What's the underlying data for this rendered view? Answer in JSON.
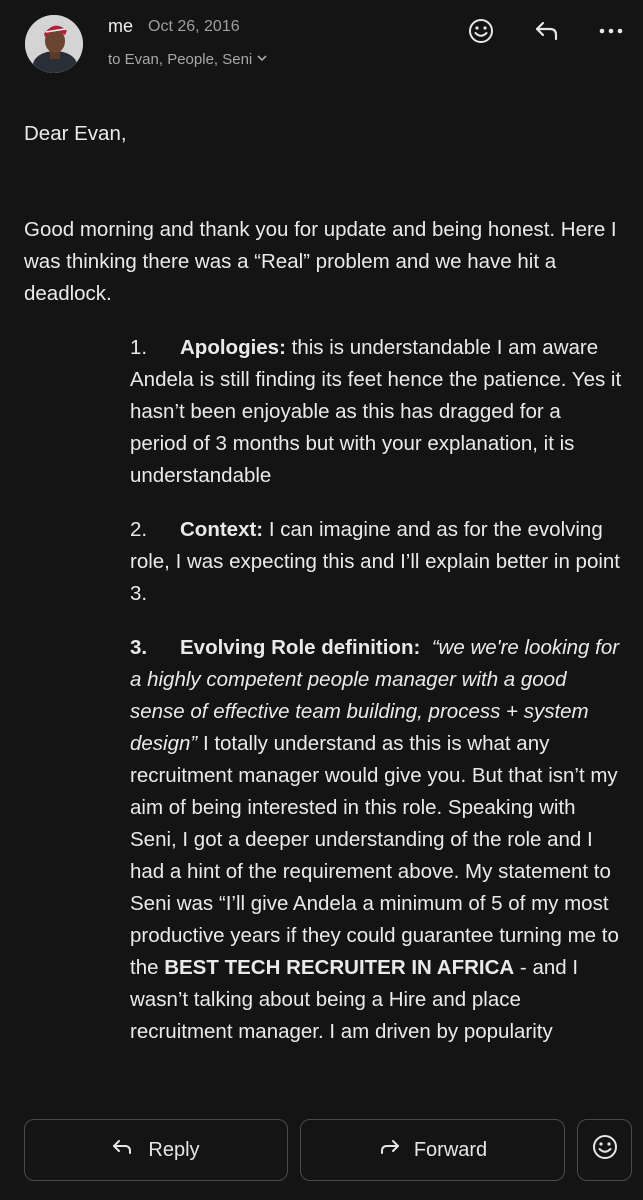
{
  "header": {
    "sender": "me",
    "date": "Oct 26, 2016",
    "recipients": "to Evan, People, Seni",
    "icons": [
      "emoji-react-icon",
      "reply-icon",
      "more-options-icon"
    ]
  },
  "body": {
    "greeting": "Dear Evan,",
    "intro": "Good morning and thank you for update and being honest. Here I was thinking there was a “Real” problem and we have hit a deadlock.",
    "points": [
      {
        "num": "1.",
        "title": "Apologies:",
        "text": " this is understandable I am aware Andela is still finding its feet hence the patience. Yes it hasn’t been enjoyable as this has dragged for a period of 3 months but with your explanation, it is understandable"
      },
      {
        "num": "2.",
        "title": "Context:",
        "text": "  I can imagine and as for the evolving role, I was expecting this and I’ll explain better in point 3."
      },
      {
        "num": "3.",
        "title": "Evolving Role definition:",
        "quote": "“we we're looking for a highly competent people manager with a good sense of effective team building, process + system design”",
        "text": " I totally understand as this is what any recruitment manager would give you. But that isn’t my aim of being interested in this role. Speaking with Seni, I got a deeper understanding of the role and I had a hint of the requirement above. My statement to Seni was “I’ll give Andela a minimum of 5 of my most productive years if they could guarantee turning me to the ",
        "emphasis": "BEST TECH RECRUITER IN AFRICA",
        "text2": " - and I wasn’t talking about being a Hire and place recruitment manager. I am driven by popularity"
      }
    ]
  },
  "actions": {
    "reply_label": "Reply",
    "forward_label": "Forward"
  }
}
